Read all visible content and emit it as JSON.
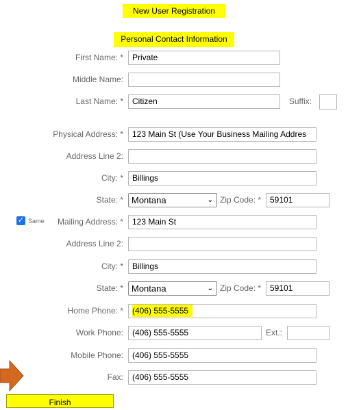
{
  "header": {
    "title": "New User Registration",
    "section": "Personal Contact Information"
  },
  "contact": {
    "first_name": {
      "label": "First Name: *",
      "value": "Private"
    },
    "middle_name": {
      "label": "Middle Name:",
      "value": ""
    },
    "last_name": {
      "label": "Last Name: *",
      "value": "Citizen"
    },
    "suffix": {
      "label": "Suffix:",
      "value": ""
    }
  },
  "physical": {
    "address": {
      "label": "Physical Address: *",
      "value": "123 Main St (Use Your Business Mailing Addres"
    },
    "line2": {
      "label": "Address Line 2:",
      "value": ""
    },
    "city": {
      "label": "City: *",
      "value": "Billings"
    },
    "state": {
      "label": "State: *",
      "value": "Montana"
    },
    "zip": {
      "label": "Zip Code: *",
      "value": "59101"
    }
  },
  "mailing": {
    "same_checkbox": {
      "label": "Same",
      "checked": true
    },
    "address": {
      "label": "Mailing Address: *",
      "value": "123 Main St"
    },
    "line2": {
      "label": "Address Line 2:",
      "value": ""
    },
    "city": {
      "label": "City: *",
      "value": "Billings"
    },
    "state": {
      "label": "State: *",
      "value": "Montana"
    },
    "zip": {
      "label": "Zip Code: *",
      "value": "59101"
    }
  },
  "phones": {
    "home": {
      "label": "Home Phone: *",
      "value": "(406) 555-5555"
    },
    "work": {
      "label": "Work Phone:",
      "value": "(406) 555-5555"
    },
    "ext": {
      "label": "Ext.:",
      "value": ""
    },
    "mobile": {
      "label": "Mobile Phone:",
      "value": "(406) 555-5555"
    },
    "fax": {
      "label": "Fax:",
      "value": "(406) 555-5555"
    }
  },
  "actions": {
    "finish_label": "Finish"
  },
  "colors": {
    "highlight": "#ffff00",
    "arrow": "#d2691e",
    "checkbox": "#1a73e8",
    "label_text": "#666666"
  }
}
